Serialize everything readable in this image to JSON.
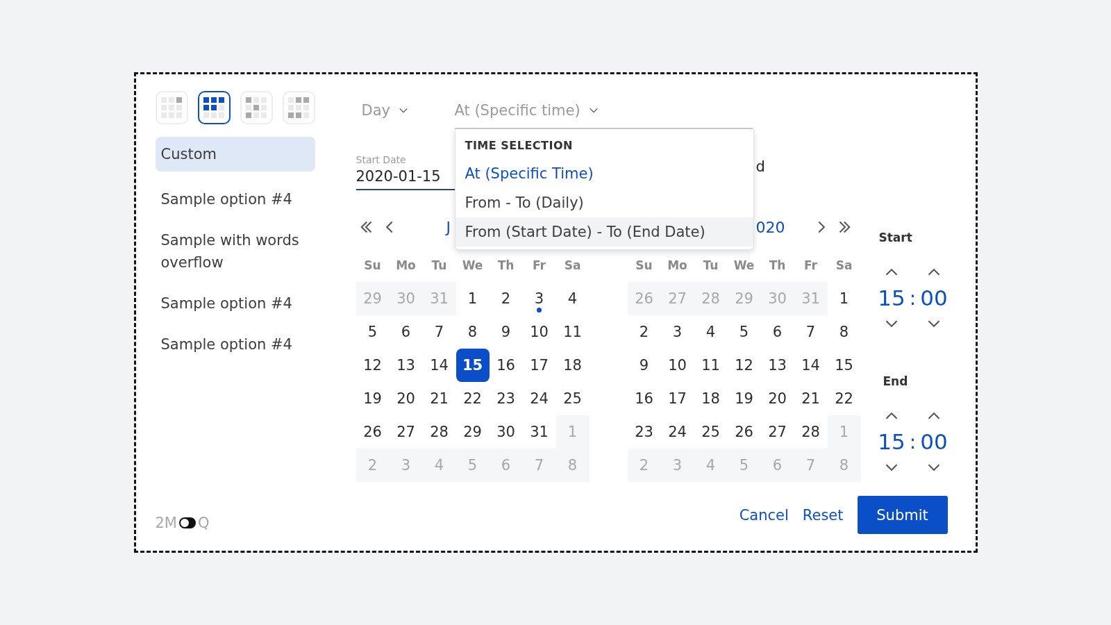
{
  "layout_buttons": [
    {
      "selected": false
    },
    {
      "selected": true
    },
    {
      "selected": false
    },
    {
      "selected": false
    }
  ],
  "presets": [
    {
      "label": "Custom",
      "selected": true
    },
    {
      "label": "Sample option #4",
      "selected": false
    },
    {
      "label": "Sample with words overflow",
      "selected": false
    },
    {
      "label": "Sample option #4",
      "selected": false
    },
    {
      "label": "Sample option #4",
      "selected": false
    }
  ],
  "granularity": {
    "value": "Day"
  },
  "time_mode": {
    "value": "At (Specific time)",
    "expanded": true
  },
  "time_menu": {
    "heading": "TIME SELECTION",
    "items": [
      {
        "label": "At (Specific Time)",
        "selected": true
      },
      {
        "label": "From - To (Daily)",
        "selected": false
      },
      {
        "label": "From (Start Date) - To (End Date)",
        "selected": false
      }
    ]
  },
  "start_date": {
    "label": "Start Date",
    "value": "2020-01-15"
  },
  "end_date_fragment": "d",
  "calendars": [
    {
      "title": "J",
      "weekdays": [
        "Su",
        "Mo",
        "Tu",
        "We",
        "Th",
        "Fr",
        "Sa"
      ],
      "weeks": [
        [
          {
            "day": "29",
            "outside": true,
            "selected": false,
            "marked": false
          },
          {
            "day": "30",
            "outside": true,
            "selected": false,
            "marked": false
          },
          {
            "day": "31",
            "outside": true,
            "selected": false,
            "marked": false
          },
          {
            "day": "1",
            "outside": false,
            "selected": false,
            "marked": false
          },
          {
            "day": "2",
            "outside": false,
            "selected": false,
            "marked": false
          },
          {
            "day": "3",
            "outside": false,
            "selected": false,
            "marked": true
          },
          {
            "day": "4",
            "outside": false,
            "selected": false,
            "marked": false
          }
        ],
        [
          {
            "day": "5",
            "outside": false,
            "selected": false,
            "marked": false
          },
          {
            "day": "6",
            "outside": false,
            "selected": false,
            "marked": false
          },
          {
            "day": "7",
            "outside": false,
            "selected": false,
            "marked": false
          },
          {
            "day": "8",
            "outside": false,
            "selected": false,
            "marked": false
          },
          {
            "day": "9",
            "outside": false,
            "selected": false,
            "marked": false
          },
          {
            "day": "10",
            "outside": false,
            "selected": false,
            "marked": false
          },
          {
            "day": "11",
            "outside": false,
            "selected": false,
            "marked": false
          }
        ],
        [
          {
            "day": "12",
            "outside": false,
            "selected": false,
            "marked": false
          },
          {
            "day": "13",
            "outside": false,
            "selected": false,
            "marked": false
          },
          {
            "day": "14",
            "outside": false,
            "selected": false,
            "marked": false
          },
          {
            "day": "15",
            "outside": false,
            "selected": true,
            "marked": false
          },
          {
            "day": "16",
            "outside": false,
            "selected": false,
            "marked": false
          },
          {
            "day": "17",
            "outside": false,
            "selected": false,
            "marked": false
          },
          {
            "day": "18",
            "outside": false,
            "selected": false,
            "marked": false
          }
        ],
        [
          {
            "day": "19",
            "outside": false,
            "selected": false,
            "marked": false
          },
          {
            "day": "20",
            "outside": false,
            "selected": false,
            "marked": false
          },
          {
            "day": "21",
            "outside": false,
            "selected": false,
            "marked": false
          },
          {
            "day": "22",
            "outside": false,
            "selected": false,
            "marked": false
          },
          {
            "day": "23",
            "outside": false,
            "selected": false,
            "marked": false
          },
          {
            "day": "24",
            "outside": false,
            "selected": false,
            "marked": false
          },
          {
            "day": "25",
            "outside": false,
            "selected": false,
            "marked": false
          }
        ],
        [
          {
            "day": "26",
            "outside": false,
            "selected": false,
            "marked": false
          },
          {
            "day": "27",
            "outside": false,
            "selected": false,
            "marked": false
          },
          {
            "day": "28",
            "outside": false,
            "selected": false,
            "marked": false
          },
          {
            "day": "29",
            "outside": false,
            "selected": false,
            "marked": false
          },
          {
            "day": "30",
            "outside": false,
            "selected": false,
            "marked": false
          },
          {
            "day": "31",
            "outside": false,
            "selected": false,
            "marked": false
          },
          {
            "day": "1",
            "outside": true,
            "selected": false,
            "marked": false
          }
        ],
        [
          {
            "day": "2",
            "outside": true,
            "selected": false,
            "marked": false
          },
          {
            "day": "3",
            "outside": true,
            "selected": false,
            "marked": false
          },
          {
            "day": "4",
            "outside": true,
            "selected": false,
            "marked": false
          },
          {
            "day": "5",
            "outside": true,
            "selected": false,
            "marked": false
          },
          {
            "day": "6",
            "outside": true,
            "selected": false,
            "marked": false
          },
          {
            "day": "7",
            "outside": true,
            "selected": false,
            "marked": false
          },
          {
            "day": "8",
            "outside": true,
            "selected": false,
            "marked": false
          }
        ]
      ]
    },
    {
      "title": "020",
      "weekdays": [
        "Su",
        "Mo",
        "Tu",
        "We",
        "Th",
        "Fr",
        "Sa"
      ],
      "weeks": [
        [
          {
            "day": "26",
            "outside": true,
            "selected": false,
            "marked": false
          },
          {
            "day": "27",
            "outside": true,
            "selected": false,
            "marked": false
          },
          {
            "day": "28",
            "outside": true,
            "selected": false,
            "marked": false
          },
          {
            "day": "29",
            "outside": true,
            "selected": false,
            "marked": false
          },
          {
            "day": "30",
            "outside": true,
            "selected": false,
            "marked": false
          },
          {
            "day": "31",
            "outside": true,
            "selected": false,
            "marked": false
          },
          {
            "day": "1",
            "outside": false,
            "selected": false,
            "marked": false
          }
        ],
        [
          {
            "day": "2",
            "outside": false,
            "selected": false,
            "marked": false
          },
          {
            "day": "3",
            "outside": false,
            "selected": false,
            "marked": false
          },
          {
            "day": "4",
            "outside": false,
            "selected": false,
            "marked": false
          },
          {
            "day": "5",
            "outside": false,
            "selected": false,
            "marked": false
          },
          {
            "day": "6",
            "outside": false,
            "selected": false,
            "marked": false
          },
          {
            "day": "7",
            "outside": false,
            "selected": false,
            "marked": false
          },
          {
            "day": "8",
            "outside": false,
            "selected": false,
            "marked": false
          }
        ],
        [
          {
            "day": "9",
            "outside": false,
            "selected": false,
            "marked": false
          },
          {
            "day": "10",
            "outside": false,
            "selected": false,
            "marked": false
          },
          {
            "day": "11",
            "outside": false,
            "selected": false,
            "marked": false
          },
          {
            "day": "12",
            "outside": false,
            "selected": false,
            "marked": false
          },
          {
            "day": "13",
            "outside": false,
            "selected": false,
            "marked": false
          },
          {
            "day": "14",
            "outside": false,
            "selected": false,
            "marked": false
          },
          {
            "day": "15",
            "outside": false,
            "selected": false,
            "marked": false
          }
        ],
        [
          {
            "day": "16",
            "outside": false,
            "selected": false,
            "marked": false
          },
          {
            "day": "17",
            "outside": false,
            "selected": false,
            "marked": false
          },
          {
            "day": "18",
            "outside": false,
            "selected": false,
            "marked": false
          },
          {
            "day": "19",
            "outside": false,
            "selected": false,
            "marked": false
          },
          {
            "day": "20",
            "outside": false,
            "selected": false,
            "marked": false
          },
          {
            "day": "21",
            "outside": false,
            "selected": false,
            "marked": false
          },
          {
            "day": "22",
            "outside": false,
            "selected": false,
            "marked": false
          }
        ],
        [
          {
            "day": "23",
            "outside": false,
            "selected": false,
            "marked": false
          },
          {
            "day": "24",
            "outside": false,
            "selected": false,
            "marked": false
          },
          {
            "day": "25",
            "outside": false,
            "selected": false,
            "marked": false
          },
          {
            "day": "26",
            "outside": false,
            "selected": false,
            "marked": false
          },
          {
            "day": "27",
            "outside": false,
            "selected": false,
            "marked": false
          },
          {
            "day": "28",
            "outside": false,
            "selected": false,
            "marked": false
          },
          {
            "day": "1",
            "outside": true,
            "selected": false,
            "marked": false
          }
        ],
        [
          {
            "day": "2",
            "outside": true,
            "selected": false,
            "marked": false
          },
          {
            "day": "3",
            "outside": true,
            "selected": false,
            "marked": false
          },
          {
            "day": "4",
            "outside": true,
            "selected": false,
            "marked": false
          },
          {
            "day": "5",
            "outside": true,
            "selected": false,
            "marked": false
          },
          {
            "day": "6",
            "outside": true,
            "selected": false,
            "marked": false
          },
          {
            "day": "7",
            "outside": true,
            "selected": false,
            "marked": false
          },
          {
            "day": "8",
            "outside": true,
            "selected": false,
            "marked": false
          }
        ]
      ]
    }
  ],
  "times": [
    {
      "label": "Start",
      "hours": "15",
      "separator": ":",
      "minutes": "00"
    },
    {
      "label": "End",
      "hours": "15",
      "separator": ":",
      "minutes": "00"
    }
  ],
  "range_toggle": {
    "left": "2M",
    "right": "Q",
    "on": false
  },
  "buttons": [
    {
      "label": "Cancel",
      "kind": "link"
    },
    {
      "label": "Reset",
      "kind": "link"
    },
    {
      "label": "Submit",
      "kind": "primary"
    }
  ]
}
